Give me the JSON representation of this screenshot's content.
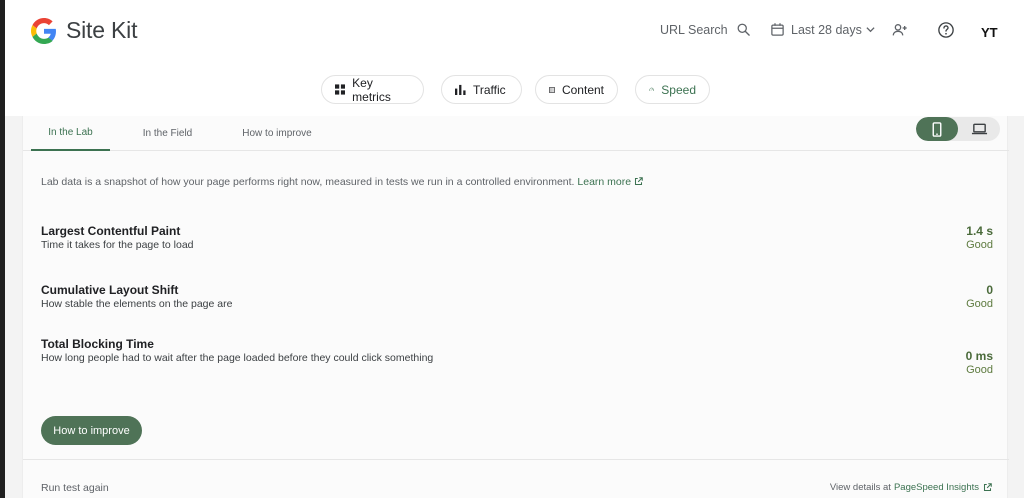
{
  "header": {
    "logo_text": "Site Kit",
    "url_search": "URL Search",
    "date_range": "Last 28 days",
    "avatar": "YT"
  },
  "chips": [
    {
      "label": "Key metrics"
    },
    {
      "label": "Traffic"
    },
    {
      "label": "Content"
    },
    {
      "label": "Speed"
    }
  ],
  "tabs": [
    {
      "label": "In the Lab"
    },
    {
      "label": "In the Field"
    },
    {
      "label": "How to improve"
    }
  ],
  "intro": {
    "text": "Lab data is a snapshot of how your page performs right now, measured in tests we run in a controlled environment.",
    "link": "Learn more"
  },
  "metrics": [
    {
      "name": "Largest Contentful Paint",
      "description": "Time it takes for the page to load",
      "value": "1.4 s",
      "rating": "Good"
    },
    {
      "name": "Cumulative Layout Shift",
      "description": "How stable the elements on the page are",
      "value": "0",
      "rating": "Good"
    },
    {
      "name": "Total Blocking Time",
      "description": "How long people had to wait after the page loaded before they could click something",
      "value": "0 ms",
      "rating": "Good"
    }
  ],
  "improve_button": "How to improve",
  "footer": {
    "run_again": "Run test again",
    "view_details": "View details at",
    "psi_link": "PageSpeed Insights"
  },
  "colors": {
    "accent": "#3c7251",
    "button_bg": "#4f7357",
    "good": "#5d7a3f"
  }
}
